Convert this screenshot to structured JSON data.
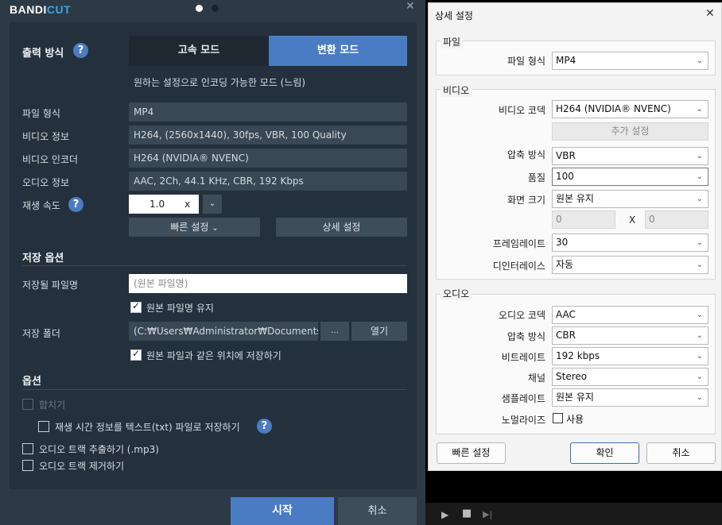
{
  "app": {
    "logo_a": "BANDI",
    "logo_b": "CUT",
    "close": "✕"
  },
  "output_mode": {
    "label": "출력 방식",
    "fast_mode": "고속 모드",
    "convert_mode": "변환 모드",
    "description": "원하는 설정으로 인코딩 가능한 모드 (느림)"
  },
  "info": {
    "file_format_label": "파일 형식",
    "file_format": "MP4",
    "video_info_label": "비디오 정보",
    "video_info": "H264, (2560x1440), 30fps, VBR, 100 Quality",
    "video_encoder_label": "비디오 인코더",
    "video_encoder": "H264 (NVIDIA® NVENC)",
    "audio_info_label": "오디오 정보",
    "audio_info": "AAC, 2Ch, 44.1 KHz, CBR, 192 Kbps",
    "speed_label": "재생 속도",
    "speed_value": "1.0",
    "speed_unit": "x",
    "quick_settings": "빠른 설정",
    "detail_settings": "상세 설정"
  },
  "save": {
    "section": "저장 옵션",
    "filename_label": "저장될 파일명",
    "filename_placeholder": "(원본 파일명)",
    "keep_name": "원본 파일명 유지",
    "folder_label": "저장 폴더",
    "folder_path": "(C:₩Users₩Administrator₩Documents₩Ba",
    "browse": "...",
    "open": "열기",
    "same_location": "원본 파일과 같은 위치에 저장하기"
  },
  "options": {
    "section": "옵션",
    "merge": "합치기",
    "save_time": "재생 시간 정보를 텍스트(txt) 파일로 저장하기",
    "extract_audio": "오디오 트랙 추출하기 (.mp3)",
    "remove_audio": "오디오 트랙 제거하기"
  },
  "actions": {
    "start": "시작",
    "cancel": "취소"
  },
  "dialog": {
    "title": "상세 설정",
    "close": "✕",
    "file_group": "파일",
    "file_format_label": "파일 형식",
    "file_format": "MP4",
    "video_group": "비디오",
    "video_codec_label": "비디오 코덱",
    "video_codec": "H264 (NVIDIA® NVENC)",
    "extra_settings": "추가 설정",
    "compression_label": "압축 방식",
    "compression": "VBR",
    "quality_label": "품질",
    "quality": "100",
    "screen_size_label": "화면 크기",
    "screen_size": "원본 유지",
    "width": "0",
    "x_sep": "X",
    "height": "0",
    "framerate_label": "프레임레이트",
    "framerate": "30",
    "deinterlace_label": "디인터레이스",
    "deinterlace": "자동",
    "audio_group": "오디오",
    "audio_codec_label": "오디오 코덱",
    "audio_codec": "AAC",
    "audio_compression_label": "압축 방식",
    "audio_compression": "CBR",
    "bitrate_label": "비트레이트",
    "bitrate": "192 kbps",
    "channel_label": "채널",
    "channel": "Stereo",
    "samplerate_label": "샘플레이트",
    "samplerate": "원본 유지",
    "normalize_label": "노멀라이즈",
    "normalize_use": "사용",
    "quick_settings": "빠른 설정",
    "ok": "확인",
    "cancel": "취소"
  },
  "colors": {
    "accent": "#4a7cc4",
    "panel": "#24303b",
    "bg": "#2d3a46"
  }
}
